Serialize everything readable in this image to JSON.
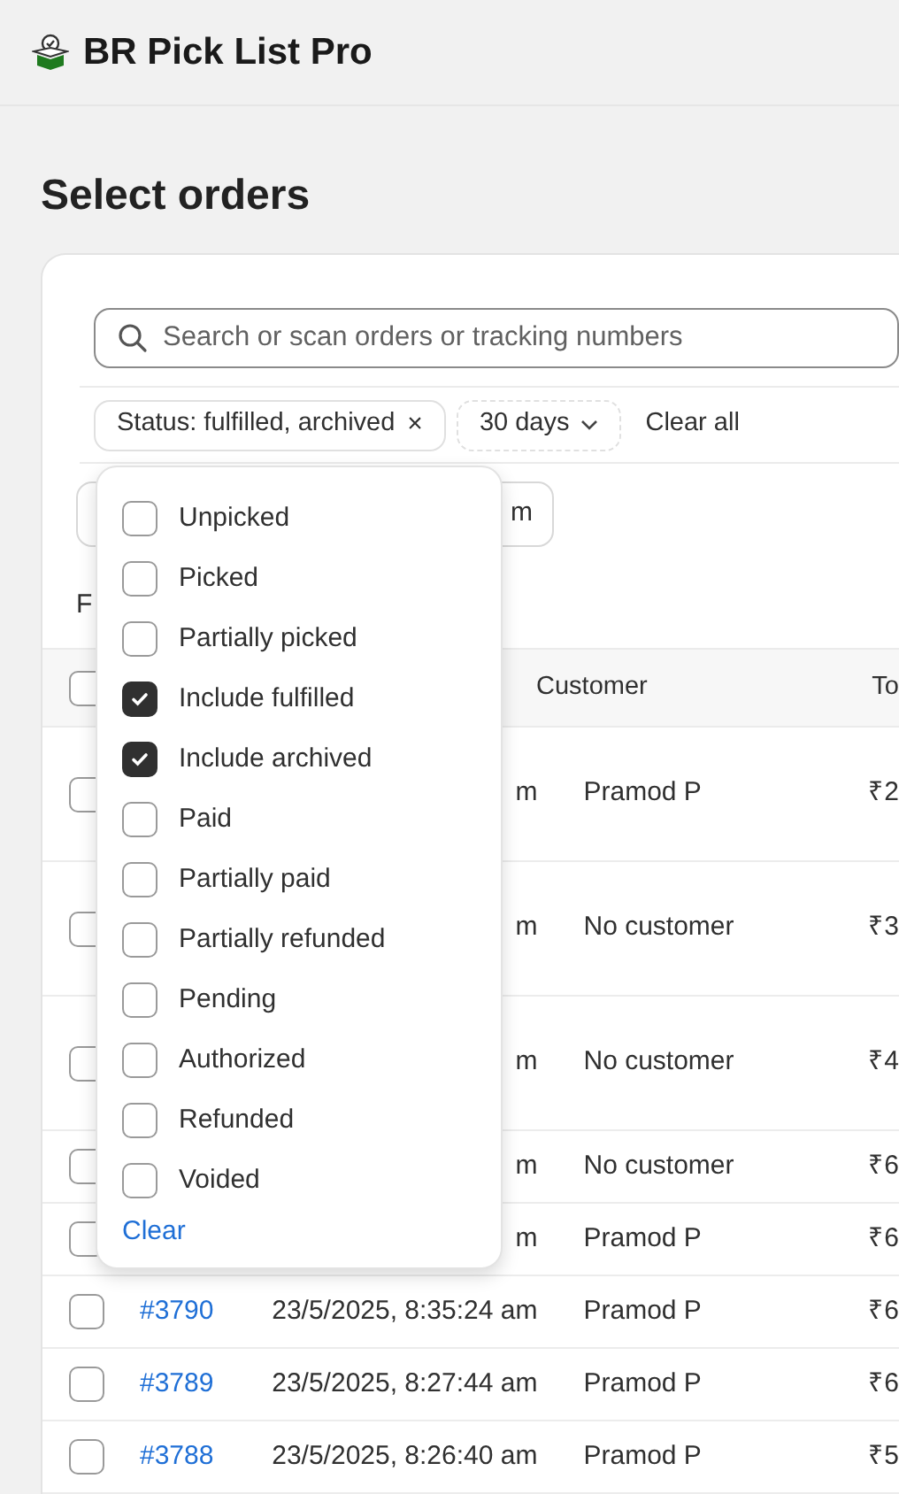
{
  "app": {
    "title": "BR Pick List Pro"
  },
  "page": {
    "title": "Select orders"
  },
  "search": {
    "placeholder": "Search or scan orders or tracking numbers"
  },
  "filters": [
    {
      "kind": "chip",
      "label": "Status: fulfilled, archived",
      "remove": "×"
    },
    {
      "kind": "dropdown",
      "label": "30 days"
    }
  ],
  "clear_all": "Clear all",
  "toolbar_button": {
    "label": "m"
  },
  "summary": "F",
  "status_menu": {
    "options": [
      {
        "label": "Unpicked",
        "checked": false
      },
      {
        "label": "Picked",
        "checked": false
      },
      {
        "label": "Partially picked",
        "checked": false
      },
      {
        "label": "Include fulfilled",
        "checked": true
      },
      {
        "label": "Include archived",
        "checked": true
      },
      {
        "label": "Paid",
        "checked": false
      },
      {
        "label": "Partially paid",
        "checked": false
      },
      {
        "label": "Partially refunded",
        "checked": false
      },
      {
        "label": "Pending",
        "checked": false
      },
      {
        "label": "Authorized",
        "checked": false
      },
      {
        "label": "Refunded",
        "checked": false
      },
      {
        "label": "Voided",
        "checked": false
      }
    ],
    "clear": "Clear"
  },
  "table": {
    "header_selected": false,
    "columns": [
      "Customer",
      "To"
    ],
    "rows": [
      {
        "selected": false,
        "date": "m",
        "customer": "Pramod P",
        "total": "₹2"
      },
      {
        "selected": false,
        "date": "m",
        "customer": "No customer",
        "total": "₹3"
      },
      {
        "selected": false,
        "date": "m",
        "customer": "No customer",
        "total": "₹4"
      },
      {
        "selected": false,
        "date": "m",
        "customer": "No customer",
        "total": "₹6"
      },
      {
        "selected": false,
        "date": "m",
        "customer": "Pramod P",
        "total": "₹6"
      },
      {
        "selected": false,
        "order": "#3790",
        "date": "23/5/2025, 8:35:24 am",
        "customer": "Pramod P",
        "total": "₹6"
      },
      {
        "selected": false,
        "order": "#3789",
        "date": "23/5/2025, 8:27:44 am",
        "customer": "Pramod P",
        "total": "₹6"
      },
      {
        "selected": false,
        "order": "#3788",
        "date": "23/5/2025, 8:26:40 am",
        "customer": "Pramod P",
        "total": "₹5"
      }
    ]
  }
}
